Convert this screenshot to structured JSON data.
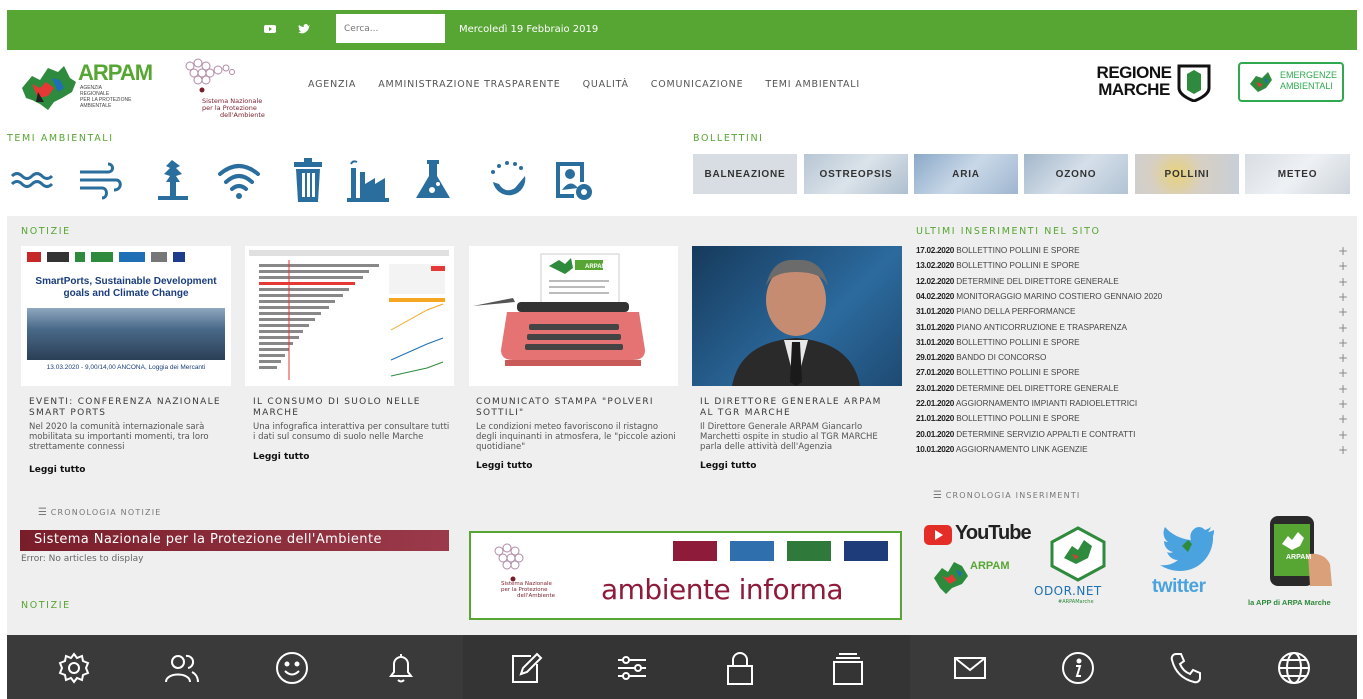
{
  "topbar": {
    "search_placeholder": "Cerca...",
    "date": "Mercoledì 19 Febbraio 2019"
  },
  "header": {
    "logo_text": "ARPAM",
    "logo_subtext": [
      "AGENZIA",
      "REGIONALE",
      "PER LA PROTEZIONE",
      "AMBIENTALE"
    ],
    "snpa_text": [
      "Sistema Nazionale",
      "per la Protezione",
      "dell'Ambiente"
    ],
    "nav": [
      "AGENZIA",
      "AMMINISTRAZIONE TRASPARENTE",
      "QUALITÀ",
      "COMUNICAZIONE",
      "TEMI AMBIENTALI"
    ],
    "regione": [
      "REGIONE",
      "MARCHE"
    ],
    "emergenze": [
      "EMERGENZE",
      "AMBIENTALI"
    ]
  },
  "temi": {
    "title": "TEMI AMBIENTALI",
    "icons": [
      "water-icon",
      "wind-icon",
      "tree-icon",
      "wifi-icon",
      "trash-icon",
      "industry-icon",
      "flask-icon",
      "eco-globe-icon",
      "user-gear-icon"
    ]
  },
  "bollettini": {
    "title": "BOLLETTINI",
    "items": [
      "BALNEAZIONE",
      "OSTREOPSIS",
      "ARIA",
      "OZONO",
      "POLLINI",
      "METEO"
    ]
  },
  "notizie": {
    "title": "NOTIZIE",
    "cards": [
      {
        "img_title": [
          "SmartPorts, Sustainable Development",
          "goals and Climate Change"
        ],
        "img_caption": "13.03.2020 - 9,00/14,00 ANCONA, Loggia dei Mercanti",
        "title": [
          "EVENTI: CONFERENZA NAZIONALE",
          "SMART PORTS"
        ],
        "desc": [
          "Nel 2020 la comunità internazionale sarà",
          "mobilitata su importanti momenti, tra loro",
          "strettamente connessi"
        ],
        "more": "Leggi tutto"
      },
      {
        "title": [
          "IL CONSUMO DI SUOLO NELLE",
          "MARCHE"
        ],
        "desc": [
          "Una infografica interattiva per consultare tutti",
          "i dati sul consumo di suolo nelle Marche"
        ],
        "more": "Leggi tutto"
      },
      {
        "title": [
          "COMUNICATO STAMPA \"POLVERI",
          "SOTTILI\""
        ],
        "desc": [
          "Le condizioni meteo favoriscono il ristagno",
          "degli inquinanti in atmosfera, le \"piccole azioni",
          "quotidiane\""
        ],
        "more": "Leggi tutto"
      },
      {
        "title": [
          "IL DIRETTORE GENERALE ARPAM",
          "AL TGR MARCHE"
        ],
        "desc": [
          "Il Direttore Generale ARPAM Giancarlo",
          "Marchetti ospite in studio al TGR MARCHE",
          "parla delle attività dell'Agenzia"
        ],
        "more": "Leggi tutto"
      }
    ],
    "crono": "CRONOLOGIA NOTIZIE",
    "bottom_title": "NOTIZIE"
  },
  "ultimi": {
    "title": "ULTIMI INSERIMENTI NEL SITO",
    "items": [
      {
        "date": "17.02.2020",
        "text": "BOLLETTINO POLLINI E SPORE"
      },
      {
        "date": "13.02.2020",
        "text": "BOLLETTINO POLLINI E SPORE"
      },
      {
        "date": "12.02.2020",
        "text": "DETERMINE DEL DIRETTORE GENERALE"
      },
      {
        "date": "04.02.2020",
        "text": "MONITORAGGIO MARINO COSTIERO GENNAIO 2020"
      },
      {
        "date": "31.01.2020",
        "text": "PIANO DELLA PERFORMANCE"
      },
      {
        "date": "31.01.2020",
        "text": "PIANO ANTICORRUZIONE E TRASPARENZA"
      },
      {
        "date": "31.01.2020",
        "text": "BOLLETTINO POLLINI E SPORE"
      },
      {
        "date": "29.01.2020",
        "text": "BANDO DI CONCORSO"
      },
      {
        "date": "27.01.2020",
        "text": "BOLLETTINO POLLINI E SPORE"
      },
      {
        "date": "23.01.2020",
        "text": "DETERMINE DEL DIRETTORE GENERALE"
      },
      {
        "date": "22.01.2020",
        "text": "AGGIORNAMENTO IMPIANTI RADIOELETTRICI"
      },
      {
        "date": "21.01.2020",
        "text": "BOLLETTINO POLLINI E SPORE"
      },
      {
        "date": "20.01.2020",
        "text": "DETERMINE SERVIZIO APPALTI E CONTRATTI"
      },
      {
        "date": "10.01.2020",
        "text": "AGGIORNAMENTO LINK AGENZIE"
      }
    ],
    "plus": "+",
    "crono": "CRONOLOGIA INSERIMENTI"
  },
  "snpa_banner": {
    "title": "Sistema Nazionale per la Protezione dell'Ambiente",
    "error": "Error: No articles to display"
  },
  "ambiente": {
    "text": "ambiente informa",
    "snpa_text": [
      "Sistema Nazionale",
      "per la Protezione",
      "dell'Ambiente"
    ]
  },
  "social": {
    "youtube": "YouTube",
    "arpam": "ARPAM",
    "odornet": "ODOR.NET",
    "odornet_sub": "#ARPAMarche",
    "twitter": "twitter",
    "app_caption": "la APP di ARPA Marche",
    "app_label": "ARPAM"
  },
  "footer": {
    "icons": [
      "settings-icon",
      "users-icon",
      "smile-icon",
      "bell-icon",
      "edit-icon",
      "sliders-icon",
      "lock-icon",
      "archive-icon",
      "mail-icon",
      "info-icon",
      "phone-icon",
      "globe-icon"
    ]
  },
  "colors": {
    "green": "#57a633",
    "blue_icon": "#2a6e9e",
    "dark_footer": "#3a3a3a",
    "content_bg": "#efefef",
    "snpa_red": "#7a1d2a"
  }
}
